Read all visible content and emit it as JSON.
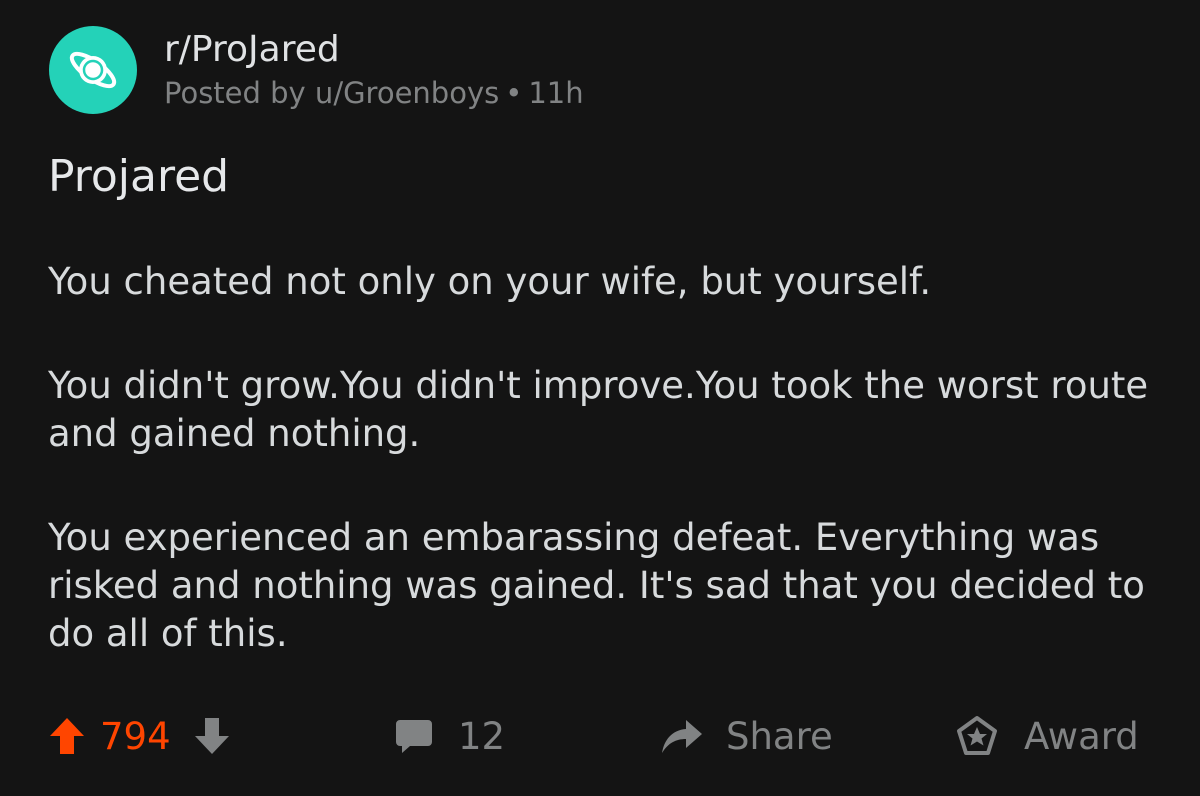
{
  "post": {
    "subreddit": "r/ProJared",
    "author_line": "Posted by u/Groenboys",
    "separator": "•",
    "age": "11h",
    "title": "Projared",
    "paragraphs": [
      "You cheated not only on your wife, but yourself.",
      "You didn't grow.You didn't improve.You took the worst route and gained nothing.",
      "You experienced an embarassing defeat. Everything was risked and nothing was gained. It's sad that you decided to do all of this."
    ]
  },
  "actions": {
    "upvotes": "794",
    "comments": "12",
    "share_label": "Share",
    "award_label": "Award"
  },
  "colors": {
    "background": "#141414",
    "avatar": "#24d2b8",
    "upvote_accent": "#ff4500",
    "muted": "#818384"
  },
  "icons": {
    "avatar": "planet-icon",
    "upvote": "arrow-up-icon",
    "downvote": "arrow-down-icon",
    "comments": "comment-bubble-icon",
    "share": "share-arrow-icon",
    "award": "award-icon"
  }
}
